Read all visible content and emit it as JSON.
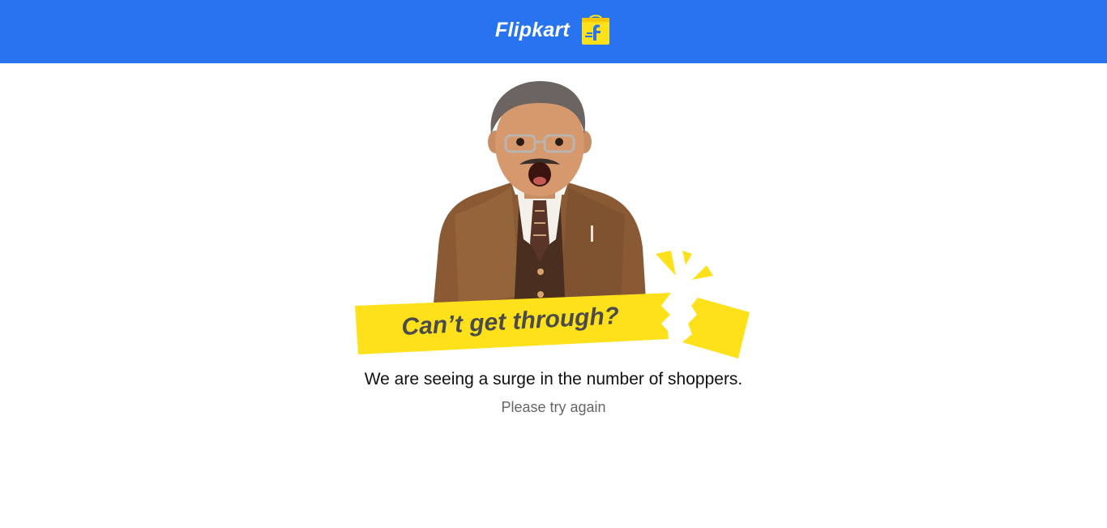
{
  "header": {
    "brand_name": "Flipkart",
    "logo_icon": "flipkart-shopping-bag-icon",
    "background_color": "#2874f0"
  },
  "illustration": {
    "banner_text": "Can’t get through?",
    "banner_color": "#ffe11b",
    "character": "surprised-boy-with-glasses-and-mustache"
  },
  "message": {
    "main": "We are seeing a surge in the number of shoppers.",
    "sub": "Please try again"
  }
}
